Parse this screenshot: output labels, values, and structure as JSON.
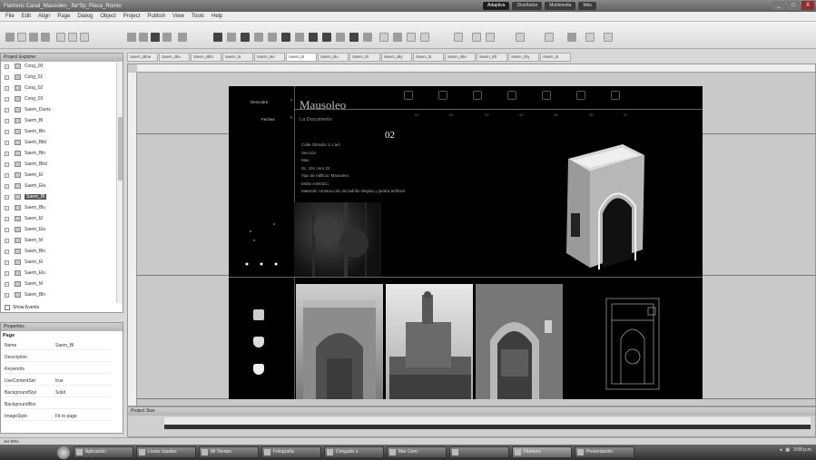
{
  "window": {
    "title": "Flamenc Canal_Mausoleo_.fla*Sp_Placa_Romio",
    "workspaces": [
      "Adaptiva",
      "Diseñador",
      "Multimedia",
      "Más"
    ],
    "controls": [
      "_",
      "□",
      "X"
    ]
  },
  "menu": [
    "File",
    "Edit",
    "Align",
    "Page",
    "Dialog",
    "Object",
    "Project",
    "Publish",
    "View",
    "Tools",
    "Help"
  ],
  "page_tabs": [
    "Saem_Blue",
    "Saem_Blu",
    "Saem_Blbl",
    "Saem_B",
    "Saem_Bu",
    "Saem_B",
    "Saem_Bu",
    "Saem_El",
    "Saem_Bly",
    "Saem_B",
    "Saem_Ble",
    "Saem_Ell",
    "Saem_Ely",
    "Saem_B"
  ],
  "active_page_tab_index": 5,
  "explorer": {
    "header": "Project Explorer",
    "items": [
      "Cong_00",
      "Cong_01",
      "Cong_02",
      "Cong_03",
      "Saem_Duets",
      "Saem_Bl",
      "Saem_Blo",
      "Saem_Blbl",
      "Saem_Blo",
      "Saem_Bbd",
      "Saem_El",
      "Saem_Ela",
      "Saem_Bl",
      "Saem_Blu",
      "Saem_El",
      "Saem_Ela",
      "Saem_M",
      "Saem_Blo",
      "Saem_El",
      "Saem_Elu",
      "Saem_M",
      "Saem_Blo"
    ],
    "selected_index": 12,
    "show_events_label": "Show Events"
  },
  "properties": {
    "header": "Properties",
    "section": "Page",
    "rows": [
      {
        "key": "Name",
        "value": "Saem_Bl"
      },
      {
        "key": "Description",
        "value": ""
      },
      {
        "key": "Keywords",
        "value": ""
      },
      {
        "key": "UseContentSet",
        "value": "true"
      },
      {
        "key": "BackgroundStyl",
        "value": "Solid"
      },
      {
        "key": "BackgroundBor",
        "value": ""
      },
      {
        "key": "ImageStyle",
        "value": "Fit to page"
      }
    ]
  },
  "design": {
    "nav_1": "Descubre",
    "nav_2": "Fechas",
    "title": "Mausoleo",
    "subtitle": "La Documento",
    "number": "02",
    "icon_labels": [
      "01",
      "02",
      "03",
      "04",
      "05",
      "06",
      "07"
    ],
    "details": [
      "Calle Obrador 1, Lleó",
      "Sección",
      "Mas",
      "Sc. 191 cero 22",
      "Tipo de edificio: Mausoleo",
      "Estilo ecléctico",
      "Material: construcción de ladrillo elegido y piedra artificial"
    ]
  },
  "timeline": {
    "header": "Project Size"
  },
  "status": "Jer 50%",
  "taskbar": {
    "tasks": [
      "Aplicación",
      "Lluvia claudes",
      "Mi Tiempo",
      "Fotografía",
      "Congado s.",
      "Mar Conc",
      "",
      "Flamenc",
      "Presentación"
    ],
    "active_index": 7,
    "tray_time": "3:08 p.m."
  },
  "colors": {
    "canvas_bg": "#000000",
    "ui_bg": "#d8d8d8"
  }
}
